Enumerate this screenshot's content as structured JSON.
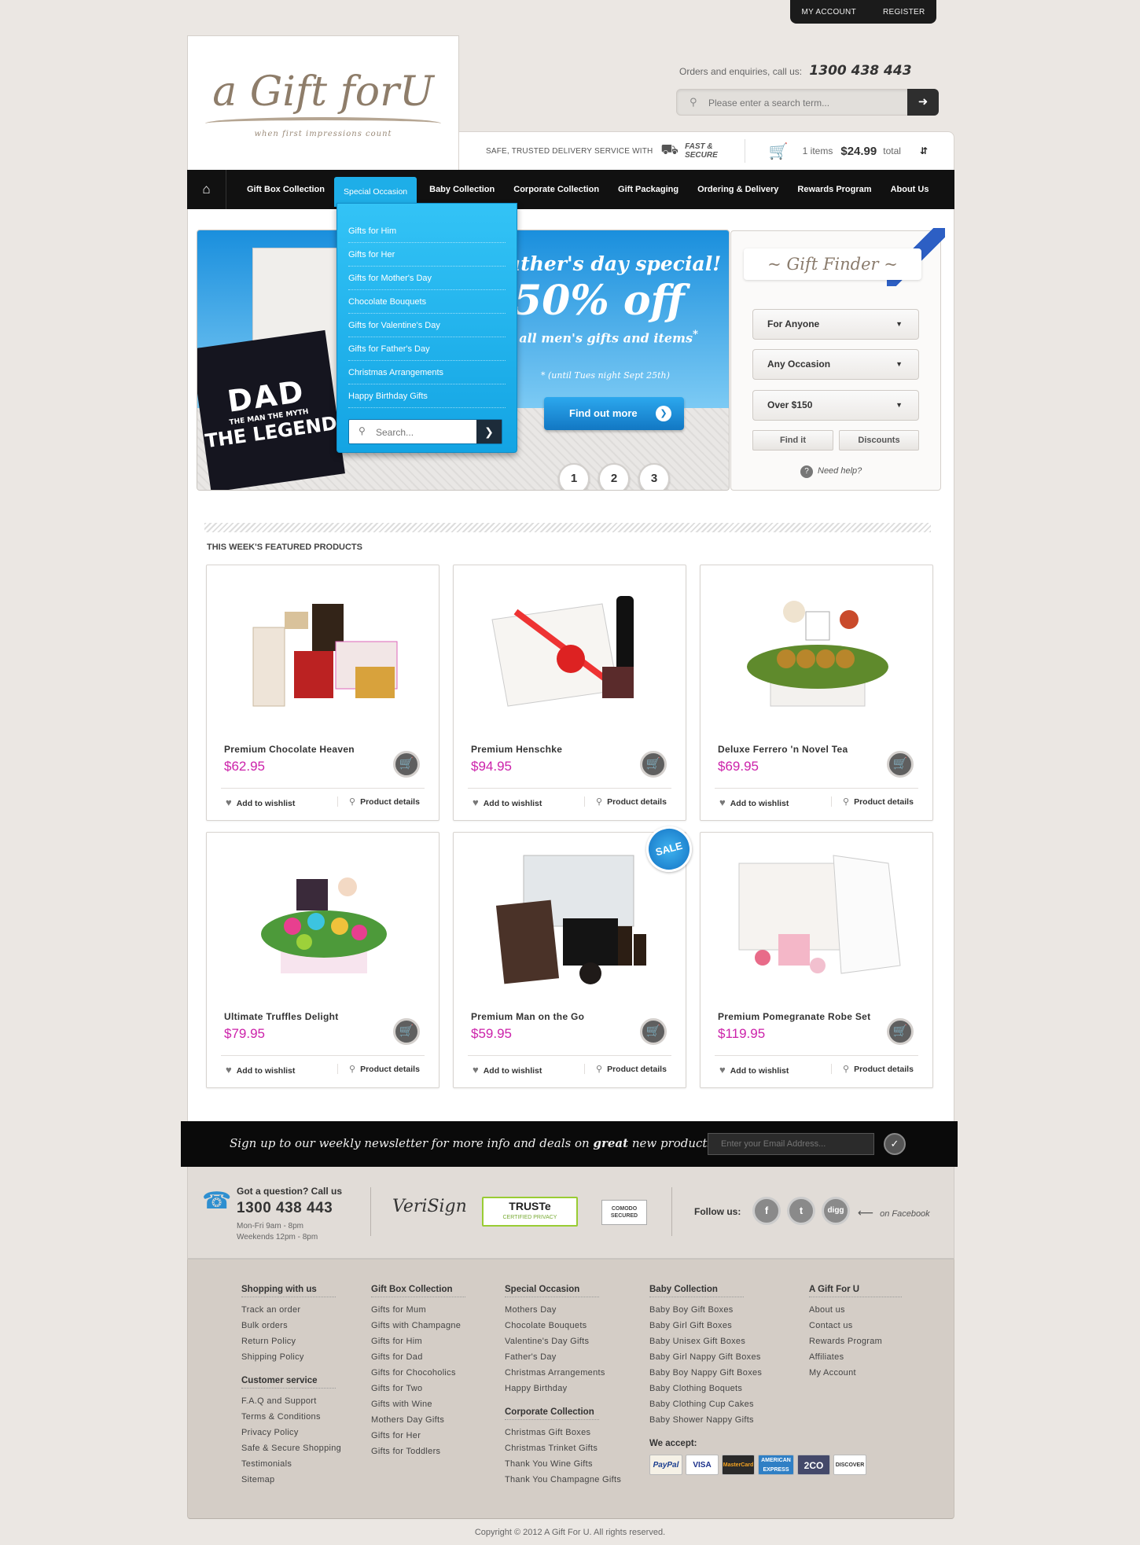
{
  "top_account": {
    "my_account": "MY ACCOUNT",
    "register": "REGISTER"
  },
  "logo": {
    "main": "a Gift forU",
    "tagline": "when first impressions count"
  },
  "header": {
    "enquiries_label": "Orders and enquiries, call us:",
    "phone": "1300 438 443"
  },
  "search": {
    "placeholder": "Please enter a search term..."
  },
  "infobar": {
    "delivery": "SAFE, TRUSTED DELIVERY SERVICE WITH",
    "fast": "FAST &",
    "secure": "SECURE",
    "cart_items": "1 items",
    "cart_total": "$24.99",
    "total_label": "total"
  },
  "nav": {
    "items": [
      "Gift Box Collection",
      "Special Occasion",
      "Baby Collection",
      "Corporate Collection",
      "Gift Packaging",
      "Ordering & Delivery",
      "Rewards Program",
      "About Us"
    ]
  },
  "dropdown": {
    "items": [
      "Gifts for Him",
      "Gifts for Her",
      "Gifts for Mother's Day",
      "Chocolate Bouquets",
      "Gifts for Valentine's Day",
      "Gifts for Father's Day",
      "Christmas Arrangements",
      "Happy Birthday Gifts"
    ],
    "search_placeholder": "Search..."
  },
  "slider": {
    "line1": "ather's day special!",
    "line2": "50% off",
    "line3": "n all men's gifts and items",
    "asterisk": "*",
    "line4": "* (until Tues night Sept 25th)",
    "button": "Find out more",
    "tee_line1": "DAD",
    "tee_line2": "THE MAN THE MYTH",
    "tee_line3": "THE LEGEND",
    "pages": [
      "1",
      "2",
      "3"
    ]
  },
  "gift_finder": {
    "title": "~ Gift Finder ~",
    "who": "For Anyone",
    "occasion": "Any Occasion",
    "price": "Over $150",
    "find_btn": "Find it",
    "discounts_btn": "Discounts",
    "help": "Need help?"
  },
  "featured": {
    "title": "THIS WEEK'S FEATURED PRODUCTS",
    "wishlist": "Add to wishlist",
    "details": "Product details",
    "sale_badge": "SALE",
    "products": [
      {
        "name": "Premium Chocolate Heaven",
        "price": "$62.95"
      },
      {
        "name": "Premium Henschke",
        "price": "$94.95"
      },
      {
        "name": "Deluxe Ferrero 'n Novel Tea",
        "price": "$69.95"
      },
      {
        "name": "Ultimate Truffles Delight",
        "price": "$79.95"
      },
      {
        "name": "Premium Man on the Go",
        "price": "$59.95"
      },
      {
        "name": "Premium Pomegranate Robe Set",
        "price": "$119.95"
      }
    ]
  },
  "newsletter": {
    "text_a": "Sign up to our weekly newsletter for more info and deals on ",
    "text_b": "great",
    "text_c": " new products:",
    "placeholder": "Enter your Email Address..."
  },
  "contact": {
    "question": "Got a question? Call us",
    "phone": "1300 438 443",
    "hours1": "Mon-Fri 9am - 8pm",
    "hours2": "Weekends 12pm - 8pm",
    "verisign": "VeriSign",
    "truste": "TRUSTe",
    "truste_sub": "CERTIFIED PRIVACY",
    "comodo": "COMODO SECURED",
    "follow": "Follow us:",
    "on_facebook": "on Facebook",
    "social": [
      "f",
      "t",
      "digg"
    ]
  },
  "footer": {
    "shopping": {
      "title": "Shopping with us",
      "links": [
        "Track an order",
        "Bulk orders",
        "Return Policy",
        "Shipping Policy"
      ]
    },
    "customer": {
      "title": "Customer service",
      "links": [
        "F.A.Q and Support",
        "Terms & Conditions",
        "Privacy Policy",
        "Safe & Secure Shopping",
        "Testimonials",
        "Sitemap"
      ]
    },
    "giftbox": {
      "title": "Gift Box Collection",
      "links": [
        "Gifts for Mum",
        "Gifts with Champagne",
        "Gifts for Him",
        "Gifts for Dad",
        "Gifts for Chocoholics",
        "Gifts for Two",
        "Gifts with Wine",
        "Mothers Day Gifts",
        "Gifts for Her",
        "Gifts for Toddlers"
      ]
    },
    "special": {
      "title": "Special Occasion",
      "links": [
        "Mothers Day",
        "Chocolate Bouquets",
        "Valentine's Day Gifts",
        "Father's Day",
        "Christmas Arrangements",
        "Happy Birthday"
      ]
    },
    "corporate": {
      "title": "Corporate Collection",
      "links": [
        "Christmas Gift Boxes",
        "Christmas Trinket Gifts",
        "Thank You Wine Gifts",
        "Thank You Champagne Gifts"
      ]
    },
    "baby": {
      "title": "Baby Collection",
      "links": [
        "Baby Boy Gift Boxes",
        "Baby Girl Gift Boxes",
        "Baby Unisex Gift Boxes",
        "Baby Girl Nappy Gift Boxes",
        "Baby Boy Nappy Gift Boxes",
        "Baby Clothing Boquets",
        "Baby Clothing Cup Cakes",
        "Baby Shower Nappy Gifts"
      ]
    },
    "about": {
      "title": "A Gift For U",
      "links": [
        "About us",
        "Contact us",
        "Rewards Program",
        "Affiliates",
        "My Account"
      ]
    },
    "we_accept": "We accept:",
    "payments": [
      "PayPal",
      "VISA",
      "MasterCard",
      "AMERICAN EXPRESS",
      "2CO",
      "DISCOVER"
    ]
  },
  "copyright": "Copyright © 2012 A Gift For U. All rights reserved."
}
